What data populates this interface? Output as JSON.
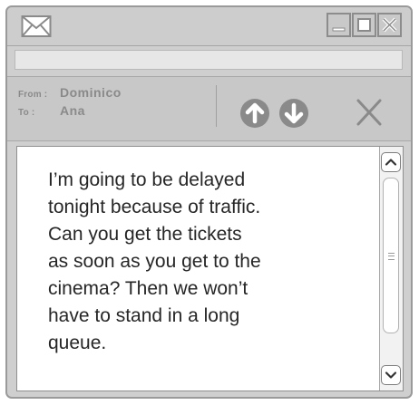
{
  "window": {
    "title_icon": "envelope-icon",
    "controls": [
      "minimize-icon",
      "maximize-icon",
      "close-icon"
    ]
  },
  "header": {
    "from_label": "From :",
    "from_value": "Dominico",
    "to_label": "To :",
    "to_value": "Ana"
  },
  "actions": [
    "up-arrow-icon",
    "down-arrow-icon",
    "delete-icon"
  ],
  "message": {
    "body": "I’m going to be delayed\ntonight because of traffic.\nCan you get the tickets\nas soon as you get to the\ncinema? Then we won’t\nhave to stand in a long\nqueue."
  },
  "colors": {
    "chrome": "#cdcdcd",
    "icon_gray": "#8a8a8a",
    "text": "#262626"
  }
}
